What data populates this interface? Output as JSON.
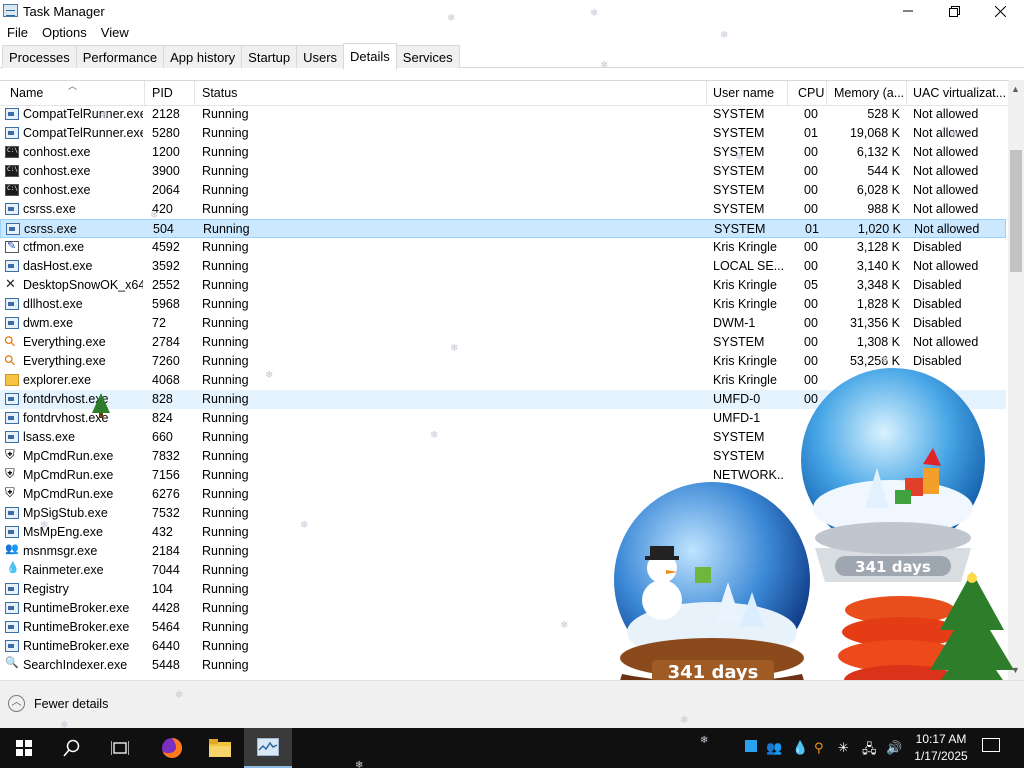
{
  "window": {
    "title": "Task Manager"
  },
  "menu": [
    "File",
    "Options",
    "View"
  ],
  "tabs": [
    "Processes",
    "Performance",
    "App history",
    "Startup",
    "Users",
    "Details",
    "Services"
  ],
  "active_tab": "Details",
  "columns": {
    "name": "Name",
    "pid": "PID",
    "status": "Status",
    "user": "User name",
    "cpu": "CPU",
    "memory": "Memory (a...",
    "uac": "UAC virtualizat..."
  },
  "rows": [
    {
      "icon": "app-icon",
      "name": "CompatTelRunner.exe",
      "pid": "2128",
      "status": "Running",
      "user": "SYSTEM",
      "cpu": "00",
      "mem": "528 K",
      "uac": "Not allowed"
    },
    {
      "icon": "app-icon",
      "name": "CompatTelRunner.exe",
      "pid": "5280",
      "status": "Running",
      "user": "SYSTEM",
      "cpu": "01",
      "mem": "19,068 K",
      "uac": "Not allowed"
    },
    {
      "icon": "console-icon",
      "name": "conhost.exe",
      "pid": "1200",
      "status": "Running",
      "user": "SYSTEM",
      "cpu": "00",
      "mem": "6,132 K",
      "uac": "Not allowed"
    },
    {
      "icon": "console-icon",
      "name": "conhost.exe",
      "pid": "3900",
      "status": "Running",
      "user": "SYSTEM",
      "cpu": "00",
      "mem": "544 K",
      "uac": "Not allowed"
    },
    {
      "icon": "console-icon",
      "name": "conhost.exe",
      "pid": "2064",
      "status": "Running",
      "user": "SYSTEM",
      "cpu": "00",
      "mem": "6,028 K",
      "uac": "Not allowed"
    },
    {
      "icon": "app-icon",
      "name": "csrss.exe",
      "pid": "420",
      "status": "Running",
      "user": "SYSTEM",
      "cpu": "00",
      "mem": "988 K",
      "uac": "Not allowed"
    },
    {
      "icon": "app-icon",
      "name": "csrss.exe",
      "pid": "504",
      "status": "Running",
      "user": "SYSTEM",
      "cpu": "01",
      "mem": "1,020 K",
      "uac": "Not allowed"
    },
    {
      "icon": "pen-icon",
      "name": "ctfmon.exe",
      "pid": "4592",
      "status": "Running",
      "user": "Kris Kringle",
      "cpu": "00",
      "mem": "3,128 K",
      "uac": "Disabled"
    },
    {
      "icon": "app-icon",
      "name": "dasHost.exe",
      "pid": "3592",
      "status": "Running",
      "user": "LOCAL SE...",
      "cpu": "00",
      "mem": "3,140 K",
      "uac": "Not allowed"
    },
    {
      "icon": "x-icon",
      "name": "DesktopSnowOK_x64...",
      "pid": "2552",
      "status": "Running",
      "user": "Kris Kringle",
      "cpu": "05",
      "mem": "3,348 K",
      "uac": "Disabled"
    },
    {
      "icon": "app-icon",
      "name": "dllhost.exe",
      "pid": "5968",
      "status": "Running",
      "user": "Kris Kringle",
      "cpu": "00",
      "mem": "1,828 K",
      "uac": "Disabled"
    },
    {
      "icon": "app-icon",
      "name": "dwm.exe",
      "pid": "72",
      "status": "Running",
      "user": "DWM-1",
      "cpu": "00",
      "mem": "31,356 K",
      "uac": "Disabled"
    },
    {
      "icon": "search-icon",
      "name": "Everything.exe",
      "pid": "2784",
      "status": "Running",
      "user": "SYSTEM",
      "cpu": "00",
      "mem": "1,308 K",
      "uac": "Not allowed"
    },
    {
      "icon": "search-icon",
      "name": "Everything.exe",
      "pid": "7260",
      "status": "Running",
      "user": "Kris Kringle",
      "cpu": "00",
      "mem": "53,256 K",
      "uac": "Disabled"
    },
    {
      "icon": "folder-icon",
      "name": "explorer.exe",
      "pid": "4068",
      "status": "Running",
      "user": "Kris Kringle",
      "cpu": "00",
      "mem": "",
      "uac": ""
    },
    {
      "icon": "app-icon",
      "name": "fontdrvhost.exe",
      "pid": "828",
      "status": "Running",
      "user": "UMFD-0",
      "cpu": "00",
      "mem": "",
      "uac": ""
    },
    {
      "icon": "app-icon",
      "name": "fontdrvhost.exe",
      "pid": "824",
      "status": "Running",
      "user": "UMFD-1",
      "cpu": "",
      "mem": "",
      "uac": ""
    },
    {
      "icon": "app-icon",
      "name": "lsass.exe",
      "pid": "660",
      "status": "Running",
      "user": "SYSTEM",
      "cpu": "",
      "mem": "",
      "uac": ""
    },
    {
      "icon": "shield-icon",
      "name": "MpCmdRun.exe",
      "pid": "7832",
      "status": "Running",
      "user": "SYSTEM",
      "cpu": "",
      "mem": "",
      "uac": ""
    },
    {
      "icon": "shield-icon",
      "name": "MpCmdRun.exe",
      "pid": "7156",
      "status": "Running",
      "user": "NETWORK...",
      "cpu": "",
      "mem": "",
      "uac": ""
    },
    {
      "icon": "shield-icon",
      "name": "MpCmdRun.exe",
      "pid": "6276",
      "status": "Running",
      "user": "",
      "cpu": "",
      "mem": "",
      "uac": ""
    },
    {
      "icon": "app-icon",
      "name": "MpSigStub.exe",
      "pid": "7532",
      "status": "Running",
      "user": "",
      "cpu": "",
      "mem": "",
      "uac": ""
    },
    {
      "icon": "app-icon",
      "name": "MsMpEng.exe",
      "pid": "432",
      "status": "Running",
      "user": "",
      "cpu": "",
      "mem": "",
      "uac": ""
    },
    {
      "icon": "people-icon",
      "name": "msnmsgr.exe",
      "pid": "2184",
      "status": "Running",
      "user": "",
      "cpu": "",
      "mem": "",
      "uac": ""
    },
    {
      "icon": "drop-icon",
      "name": "Rainmeter.exe",
      "pid": "7044",
      "status": "Running",
      "user": "",
      "cpu": "",
      "mem": "",
      "uac": ""
    },
    {
      "icon": "app-icon",
      "name": "Registry",
      "pid": "104",
      "status": "Running",
      "user": "",
      "cpu": "",
      "mem": "",
      "uac": ""
    },
    {
      "icon": "app-icon",
      "name": "RuntimeBroker.exe",
      "pid": "4428",
      "status": "Running",
      "user": "",
      "cpu": "",
      "mem": "",
      "uac": ""
    },
    {
      "icon": "app-icon",
      "name": "RuntimeBroker.exe",
      "pid": "5464",
      "status": "Running",
      "user": "",
      "cpu": "",
      "mem": "",
      "uac": ""
    },
    {
      "icon": "app-icon",
      "name": "RuntimeBroker.exe",
      "pid": "6440",
      "status": "Running",
      "user": "",
      "cpu": "",
      "mem": "",
      "uac": ""
    },
    {
      "icon": "search-index-icon",
      "name": "SearchIndexer.exe",
      "pid": "5448",
      "status": "Running",
      "user": "",
      "cpu": "",
      "mem": "",
      "uac": ""
    }
  ],
  "selected_row": 6,
  "hover_row": 15,
  "footer": {
    "fewer_details": "Fewer details"
  },
  "globes": [
    {
      "label": "341 days"
    },
    {
      "label": "341 days"
    }
  ],
  "clock": {
    "time": "10:17 AM",
    "date": "1/17/2025"
  },
  "colors": {
    "selection": "#cce8ff",
    "taskbar": "#101010",
    "accent": "#0078d7"
  }
}
